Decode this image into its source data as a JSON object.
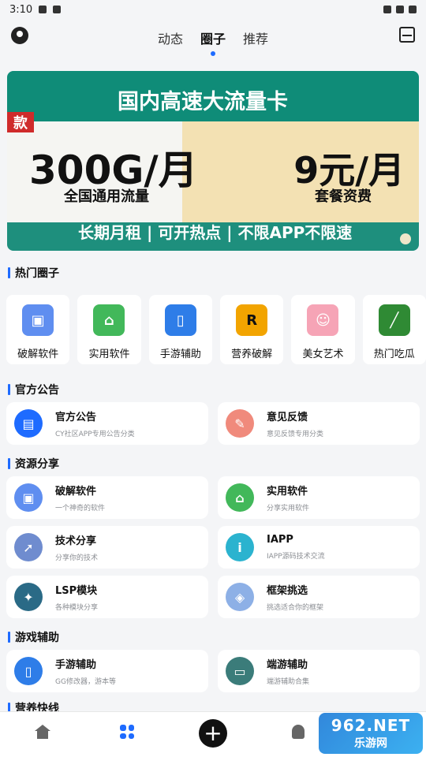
{
  "status": {
    "time": "3:10"
  },
  "nav": {
    "tabs": [
      "动态",
      "圈子",
      "推荐"
    ],
    "active": "圈子"
  },
  "banner": {
    "title": "国内高速大流量卡",
    "tag": "款",
    "left_big": "300G/月",
    "left_small": "全国通用流量",
    "right_big": "9元/月",
    "right_small": "套餐资费",
    "bottom": "长期月租 | 可开热点 | 不限APP不限速"
  },
  "sections": {
    "hot": "热门圈子",
    "official": "官方公告",
    "resources": "资源分享",
    "games": "游戏辅助",
    "nutrition": "营养快线"
  },
  "hot_items": [
    {
      "label": "破解软件",
      "color": "#5f8ef0",
      "icon": "folder-key-icon"
    },
    {
      "label": "实用软件",
      "color": "#42b85a",
      "icon": "shopping-bag-icon"
    },
    {
      "label": "手游辅助",
      "color": "#2e7de8",
      "icon": "phone-icon"
    },
    {
      "label": "营养破解",
      "color": "#f2a400",
      "icon": "r-star-icon"
    },
    {
      "label": "美女艺术",
      "color": "#f6a4b6",
      "icon": "girl-avatar-icon"
    },
    {
      "label": "热门吃瓜",
      "color": "#2f8a34",
      "icon": "cucumber-icon"
    }
  ],
  "official_cards": [
    {
      "title": "官方公告",
      "subtitle": "CY社区APP专用公告分类",
      "color": "#1e6bff",
      "icon": "briefcase-icon"
    },
    {
      "title": "意见反馈",
      "subtitle": "意见反馈专用分类",
      "color": "#f08a7c",
      "icon": "feedback-pencil-icon"
    }
  ],
  "resource_cards": [
    {
      "title": "破解软件",
      "subtitle": "一个神奇的软件",
      "color": "#5f8ef0",
      "icon": "folder-key-icon"
    },
    {
      "title": "实用软件",
      "subtitle": "分享实用软件",
      "color": "#42b85a",
      "icon": "shopping-bag-icon"
    },
    {
      "title": "技术分享",
      "subtitle": "分享你的技术",
      "color": "#6f8ccf",
      "icon": "rocket-icon"
    },
    {
      "title": "IAPP",
      "subtitle": "IAPP源码技术交流",
      "color": "#2bb3cf",
      "icon": "info-i-icon"
    },
    {
      "title": "LSP模块",
      "subtitle": "各种模块分享",
      "color": "#2a6a86",
      "icon": "module-icon"
    },
    {
      "title": "框架挑选",
      "subtitle": "挑选适合你的框架",
      "color": "#8db0e6",
      "icon": "shield-cube-icon"
    }
  ],
  "game_cards": [
    {
      "title": "手游辅助",
      "subtitle": "GG修改器，游本等",
      "color": "#2e7de8",
      "icon": "phone-icon"
    },
    {
      "title": "端游辅助",
      "subtitle": "端游辅助合集",
      "color": "#3b7c7a",
      "icon": "monitor-icon"
    }
  ],
  "watermark": {
    "top": "962.NET",
    "bottom": "乐游网"
  }
}
